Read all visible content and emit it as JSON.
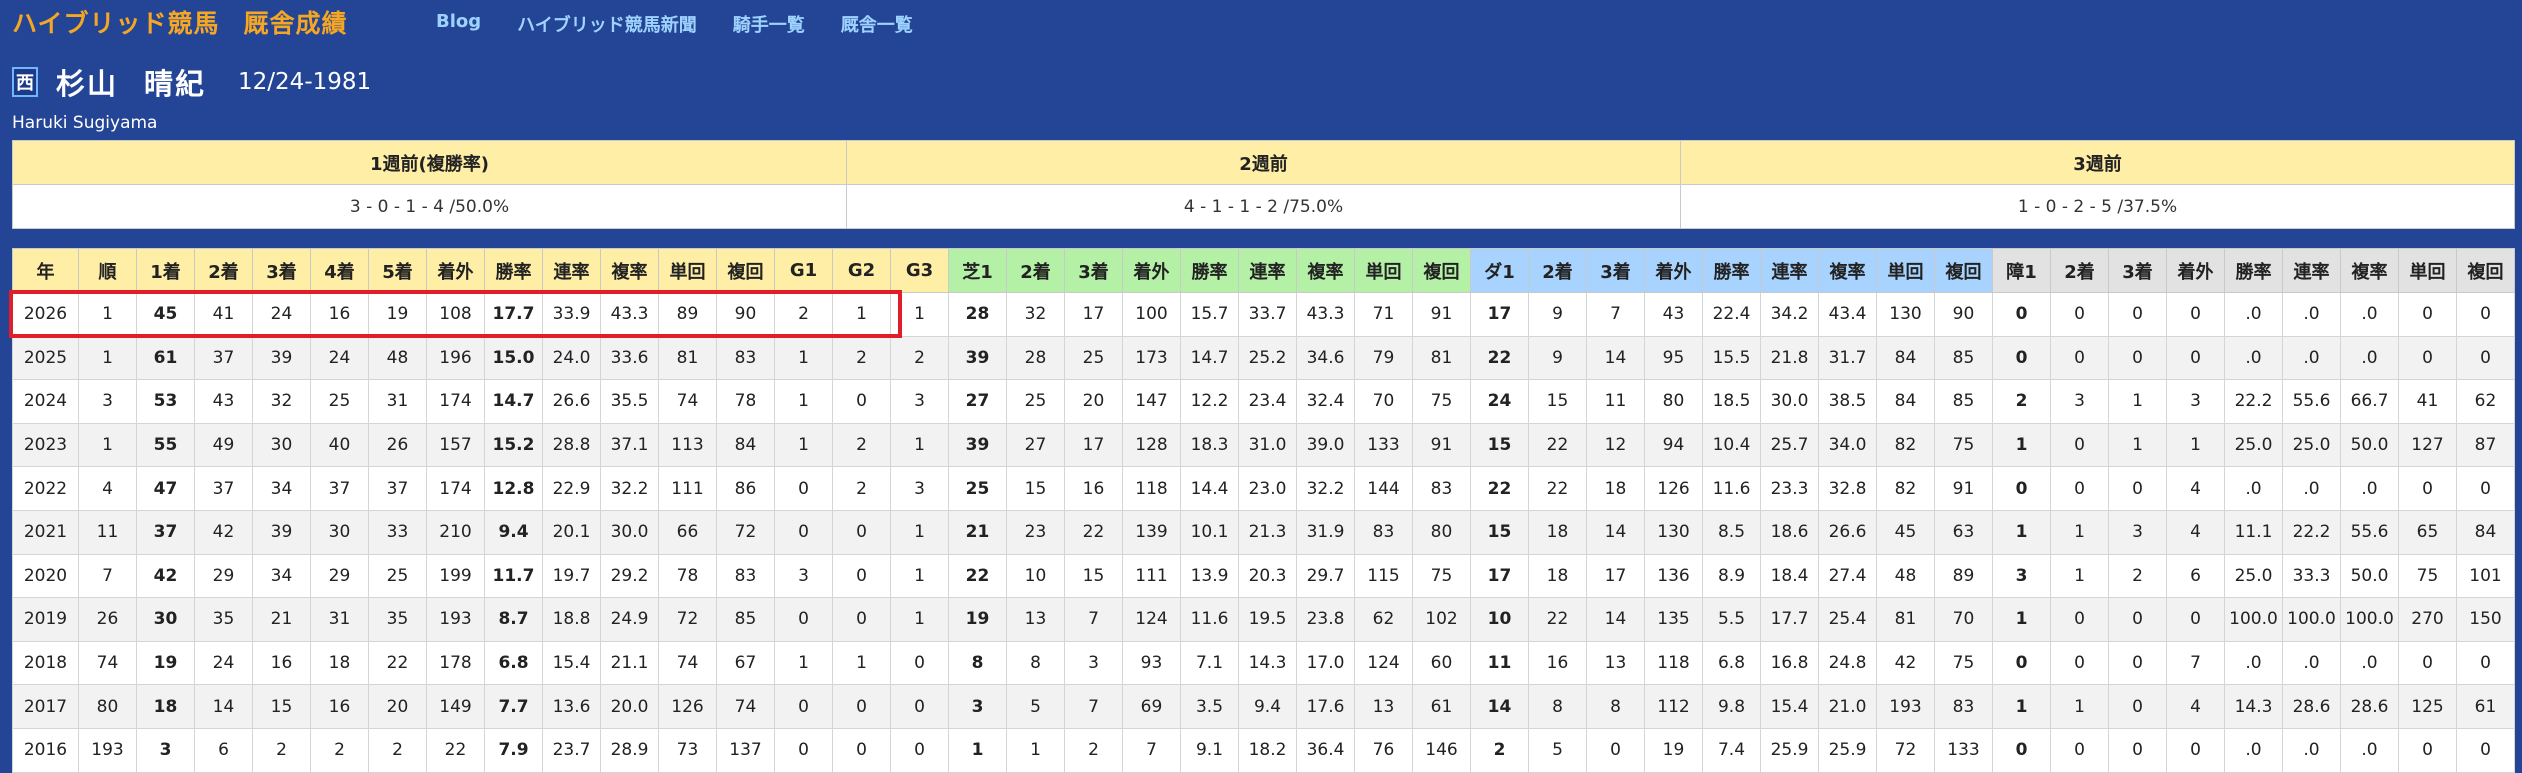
{
  "brand": {
    "part1": "ハイブリッド競馬",
    "part2": "厩舎成績"
  },
  "nav": [
    {
      "label": "Blog"
    },
    {
      "label": "ハイブリッド競馬新聞"
    },
    {
      "label": "騎手一覧"
    },
    {
      "label": "厩舎一覧"
    }
  ],
  "jockey": {
    "region": "西",
    "last_name": "杉山",
    "first_name": "晴紀",
    "birth": "12/24-1981",
    "romaji": "Haruki Sugiyama"
  },
  "weeks": {
    "headers": [
      "1週前(複勝率)",
      "2週前",
      "3週前"
    ],
    "values": [
      "3 - 0 - 1 - 4 /50.0%",
      "4 - 1 - 1 - 2 /75.0%",
      "1 - 0 - 2 - 5 /37.5%"
    ]
  },
  "colors": {
    "header_yellow": "#ffeea6",
    "header_green": "#b4f0a6",
    "header_blue": "#a8d3ff",
    "header_gray": "#e2e2e2",
    "highlight_red": "#e11d2a"
  },
  "stats_table": {
    "headers": [
      "年",
      "順",
      "1着",
      "2着",
      "3着",
      "4着",
      "5着",
      "着外",
      "勝率",
      "連率",
      "複率",
      "単回",
      "複回",
      "G1",
      "G2",
      "G3",
      "芝1",
      "2着",
      "3着",
      "着外",
      "勝率",
      "連率",
      "複率",
      "単回",
      "複回",
      "ダ1",
      "2着",
      "3着",
      "着外",
      "勝率",
      "連率",
      "複率",
      "単回",
      "複回",
      "障1",
      "2着",
      "3着",
      "着外",
      "勝率",
      "連率",
      "複率",
      "単回",
      "複回"
    ],
    "rows": [
      [
        "2026",
        "1",
        "45",
        "41",
        "24",
        "16",
        "19",
        "108",
        "17.7",
        "33.9",
        "43.3",
        "89",
        "90",
        "2",
        "1",
        "1",
        "28",
        "32",
        "17",
        "100",
        "15.7",
        "33.7",
        "43.3",
        "71",
        "91",
        "17",
        "9",
        "7",
        "43",
        "22.4",
        "34.2",
        "43.4",
        "130",
        "90",
        "0",
        "0",
        "0",
        "0",
        ".0",
        ".0",
        ".0",
        "0",
        "0"
      ],
      [
        "2025",
        "1",
        "61",
        "37",
        "39",
        "24",
        "48",
        "196",
        "15.0",
        "24.0",
        "33.6",
        "81",
        "83",
        "1",
        "2",
        "2",
        "39",
        "28",
        "25",
        "173",
        "14.7",
        "25.2",
        "34.6",
        "79",
        "81",
        "22",
        "9",
        "14",
        "95",
        "15.5",
        "21.8",
        "31.7",
        "84",
        "85",
        "0",
        "0",
        "0",
        "0",
        ".0",
        ".0",
        ".0",
        "0",
        "0"
      ],
      [
        "2024",
        "3",
        "53",
        "43",
        "32",
        "25",
        "31",
        "174",
        "14.7",
        "26.6",
        "35.5",
        "74",
        "78",
        "1",
        "0",
        "3",
        "27",
        "25",
        "20",
        "147",
        "12.2",
        "23.4",
        "32.4",
        "70",
        "75",
        "24",
        "15",
        "11",
        "80",
        "18.5",
        "30.0",
        "38.5",
        "84",
        "85",
        "2",
        "3",
        "1",
        "3",
        "22.2",
        "55.6",
        "66.7",
        "41",
        "62"
      ],
      [
        "2023",
        "1",
        "55",
        "49",
        "30",
        "40",
        "26",
        "157",
        "15.2",
        "28.8",
        "37.1",
        "113",
        "84",
        "1",
        "2",
        "1",
        "39",
        "27",
        "17",
        "128",
        "18.3",
        "31.0",
        "39.0",
        "133",
        "91",
        "15",
        "22",
        "12",
        "94",
        "10.4",
        "25.7",
        "34.0",
        "82",
        "75",
        "1",
        "0",
        "1",
        "1",
        "25.0",
        "25.0",
        "50.0",
        "127",
        "87"
      ],
      [
        "2022",
        "4",
        "47",
        "37",
        "34",
        "37",
        "37",
        "174",
        "12.8",
        "22.9",
        "32.2",
        "111",
        "86",
        "0",
        "2",
        "3",
        "25",
        "15",
        "16",
        "118",
        "14.4",
        "23.0",
        "32.2",
        "144",
        "83",
        "22",
        "22",
        "18",
        "126",
        "11.6",
        "23.3",
        "32.8",
        "82",
        "91",
        "0",
        "0",
        "0",
        "4",
        ".0",
        ".0",
        ".0",
        "0",
        "0"
      ],
      [
        "2021",
        "11",
        "37",
        "42",
        "39",
        "30",
        "33",
        "210",
        "9.4",
        "20.1",
        "30.0",
        "66",
        "72",
        "0",
        "0",
        "1",
        "21",
        "23",
        "22",
        "139",
        "10.1",
        "21.3",
        "31.9",
        "83",
        "80",
        "15",
        "18",
        "14",
        "130",
        "8.5",
        "18.6",
        "26.6",
        "45",
        "63",
        "1",
        "1",
        "3",
        "4",
        "11.1",
        "22.2",
        "55.6",
        "65",
        "84"
      ],
      [
        "2020",
        "7",
        "42",
        "29",
        "34",
        "29",
        "25",
        "199",
        "11.7",
        "19.7",
        "29.2",
        "78",
        "83",
        "3",
        "0",
        "1",
        "22",
        "10",
        "15",
        "111",
        "13.9",
        "20.3",
        "29.7",
        "115",
        "75",
        "17",
        "18",
        "17",
        "136",
        "8.9",
        "18.4",
        "27.4",
        "48",
        "89",
        "3",
        "1",
        "2",
        "6",
        "25.0",
        "33.3",
        "50.0",
        "75",
        "101"
      ],
      [
        "2019",
        "26",
        "30",
        "35",
        "21",
        "31",
        "35",
        "193",
        "8.7",
        "18.8",
        "24.9",
        "72",
        "85",
        "0",
        "0",
        "1",
        "19",
        "13",
        "7",
        "124",
        "11.6",
        "19.5",
        "23.8",
        "62",
        "102",
        "10",
        "22",
        "14",
        "135",
        "5.5",
        "17.7",
        "25.4",
        "81",
        "70",
        "1",
        "0",
        "0",
        "0",
        "100.0",
        "100.0",
        "100.0",
        "270",
        "150"
      ],
      [
        "2018",
        "74",
        "19",
        "24",
        "16",
        "18",
        "22",
        "178",
        "6.8",
        "15.4",
        "21.1",
        "74",
        "67",
        "1",
        "1",
        "0",
        "8",
        "8",
        "3",
        "93",
        "7.1",
        "14.3",
        "17.0",
        "124",
        "60",
        "11",
        "16",
        "13",
        "118",
        "6.8",
        "16.8",
        "24.8",
        "42",
        "75",
        "0",
        "0",
        "0",
        "7",
        ".0",
        ".0",
        ".0",
        "0",
        "0"
      ],
      [
        "2017",
        "80",
        "18",
        "14",
        "15",
        "16",
        "20",
        "149",
        "7.7",
        "13.6",
        "20.0",
        "126",
        "74",
        "0",
        "0",
        "0",
        "3",
        "5",
        "7",
        "69",
        "3.5",
        "9.4",
        "17.6",
        "13",
        "61",
        "14",
        "8",
        "8",
        "112",
        "9.8",
        "15.4",
        "21.0",
        "193",
        "83",
        "1",
        "1",
        "0",
        "4",
        "14.3",
        "28.6",
        "28.6",
        "125",
        "61"
      ],
      [
        "2016",
        "193",
        "3",
        "6",
        "2",
        "2",
        "2",
        "22",
        "7.9",
        "23.7",
        "28.9",
        "73",
        "137",
        "0",
        "0",
        "0",
        "1",
        "1",
        "2",
        "7",
        "9.1",
        "18.2",
        "36.4",
        "76",
        "146",
        "2",
        "5",
        "0",
        "19",
        "7.4",
        "25.9",
        "25.9",
        "72",
        "133",
        "0",
        "0",
        "0",
        "0",
        ".0",
        ".0",
        ".0",
        "0",
        "0"
      ]
    ]
  }
}
